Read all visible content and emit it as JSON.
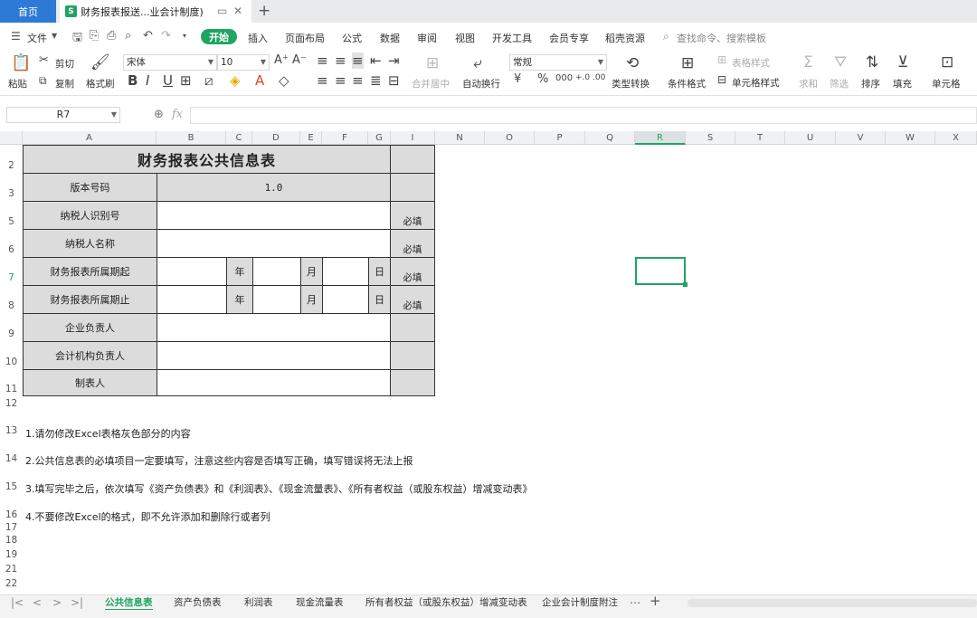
{
  "tabs": {
    "home": "首页",
    "doc_title": "财务报表报送...业会计制度)",
    "doc_icon": "S"
  },
  "menu": {
    "file": "文件",
    "items": [
      "开始",
      "插入",
      "页面布局",
      "公式",
      "数据",
      "审阅",
      "视图",
      "开发工具",
      "会员专享",
      "稻壳资源"
    ],
    "search_placeholder": "查找命令、搜索模板"
  },
  "ribbon": {
    "cut": "剪切",
    "paste": "粘贴",
    "copy": "复制",
    "format_painter": "格式刷",
    "font_name": "宋体",
    "font_size": "10",
    "merge_center": "合并居中",
    "wrap_text": "自动换行",
    "number_format": "常规",
    "type_convert": "类型转换",
    "conditional_format": "条件格式",
    "table_style": "表格样式",
    "cell_style": "单元格样式",
    "sum": "求和",
    "filter": "筛选",
    "sort": "排序",
    "fill": "填充",
    "cell": "单元格"
  },
  "formula_bar": {
    "name_box": "R7",
    "fx": "fx"
  },
  "columns": [
    "A",
    "B",
    "C",
    "D",
    "E",
    "F",
    "G",
    "I",
    "N",
    "O",
    "P",
    "Q",
    "R",
    "S",
    "T",
    "U",
    "V",
    "W",
    "X"
  ],
  "rows": [
    "2",
    "3",
    "5",
    "6",
    "7",
    "8",
    "9",
    "10",
    "11",
    "12",
    "13",
    "14",
    "15",
    "16",
    "17",
    "18",
    "19",
    "21",
    "22"
  ],
  "form": {
    "title": "财务报表公共信息表",
    "version_label": "版本号码",
    "version_value": "1.0",
    "taxpayer_id": "纳税人识别号",
    "taxpayer_name": "纳税人名称",
    "period_start": "财务报表所属期起",
    "period_end": "财务报表所属期止",
    "year": "年",
    "month": "月",
    "day": "日",
    "leader": "企业负责人",
    "accounting_head": "会计机构负责人",
    "preparer": "制表人",
    "required": "必填"
  },
  "notes": [
    "1.请勿修改Excel表格灰色部分的内容",
    "2.公共信息表的必填项目一定要填写，注意这些内容是否填写正确，填写错误将无法上报",
    "3.填写完毕之后，依次填写《资产负债表》和《利润表》、《现金流量表》、《所有者权益（或股东权益）增减变动表》",
    "4.不要修改Excel的格式，即不允许添加和删除行或者列"
  ],
  "sheets": [
    "公共信息表",
    "资产负债表",
    "利润表",
    "现金流量表",
    "所有者权益（或股东权益）增减变动表",
    "企业会计制度附注"
  ],
  "selected_cell": "R7",
  "colors": {
    "accent": "#1fa463",
    "home_tab": "#2d7ad6",
    "locked_cell": "#dcdcdc"
  }
}
